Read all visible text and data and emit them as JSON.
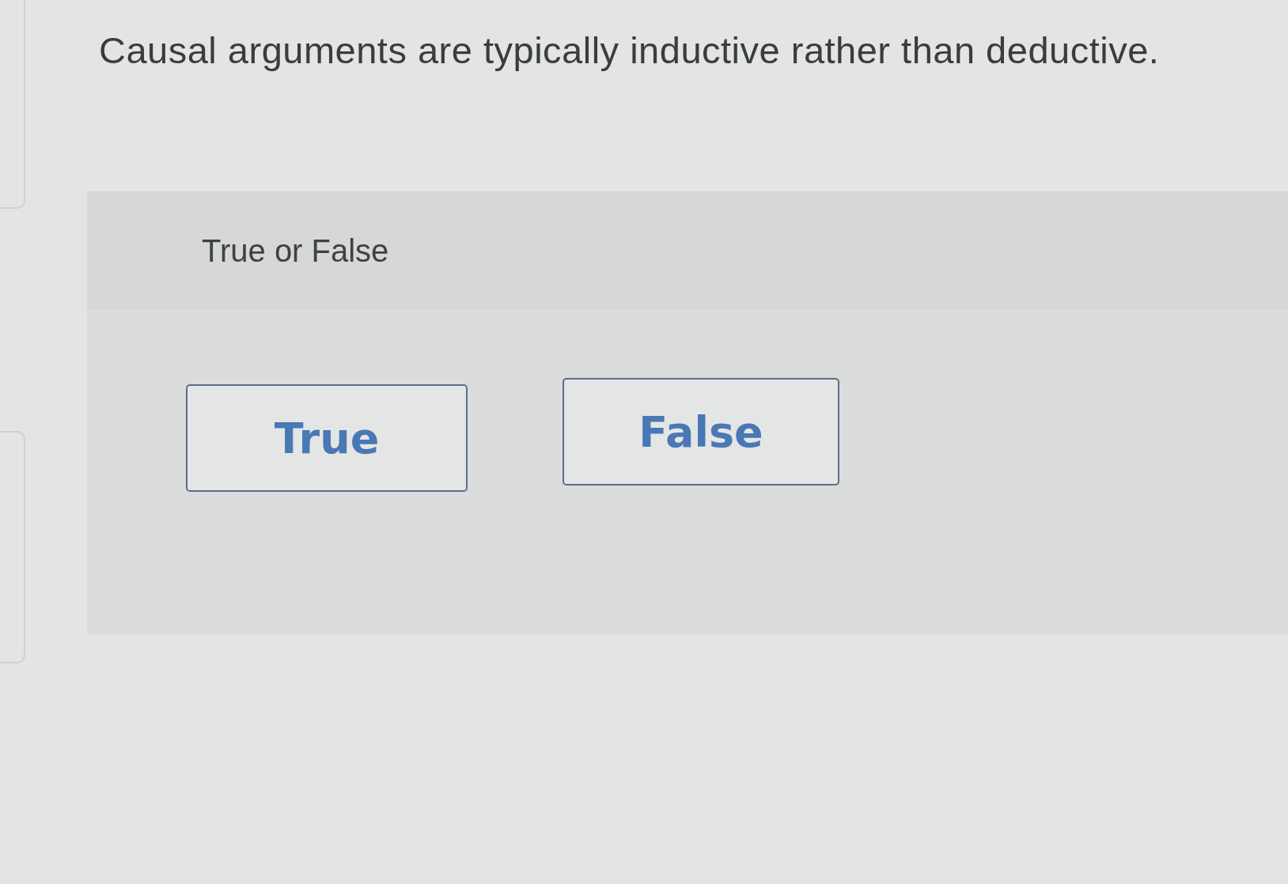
{
  "question": {
    "text": "Causal arguments are typically inductive rather than deductive."
  },
  "answer_panel": {
    "prompt": "True or False",
    "options": [
      {
        "label": "True",
        "selected": false
      },
      {
        "label": "False",
        "selected": false
      }
    ]
  }
}
